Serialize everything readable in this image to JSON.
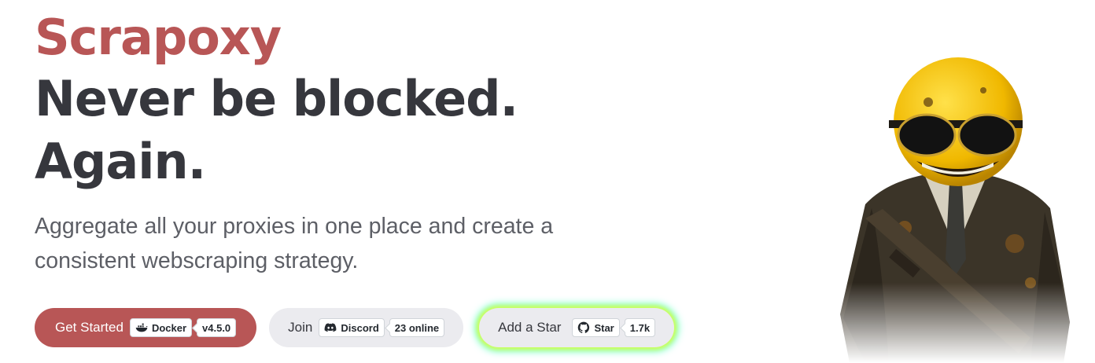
{
  "hero": {
    "brand": "Scrapoxy",
    "headline_line1": "Never be blocked.",
    "headline_line2": "Again.",
    "tagline": "Aggregate all your proxies in one place and create a consistent webscraping strategy."
  },
  "cta": {
    "get_started": {
      "label": "Get Started",
      "badge_icon": "docker-icon",
      "badge_label": "Docker",
      "badge_count": "v4.5.0"
    },
    "join": {
      "label": "Join",
      "badge_icon": "discord-icon",
      "badge_label": "Discord",
      "badge_count": "23 online"
    },
    "star": {
      "label": "Add a Star",
      "badge_icon": "github-icon",
      "badge_label": "Star",
      "badge_count": "1.7k"
    }
  },
  "colors": {
    "brand": "#b85656",
    "headline": "#36373d",
    "tagline": "#5d5f66",
    "pill_secondary": "#ebebef",
    "mascot_face": "#f4c20d"
  },
  "illustration": {
    "icon": "mascot-icon"
  }
}
